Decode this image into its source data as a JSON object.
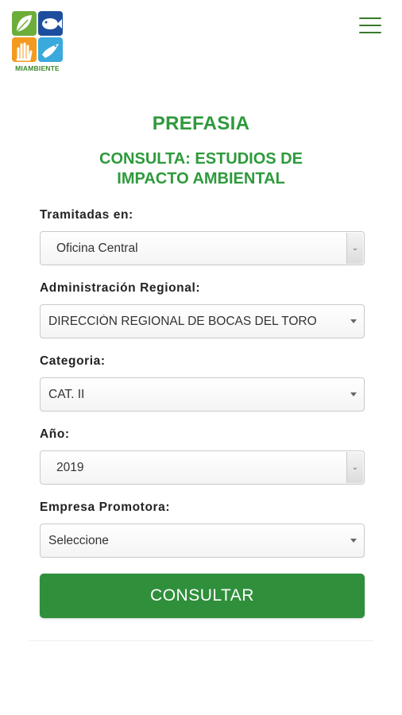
{
  "header": {
    "logo_text": "MIAMBIENTE",
    "menu_icon": "hamburger-menu-icon",
    "logo_colors": [
      "#6dad3a",
      "#1d4e9e",
      "#f39a1f",
      "#3aa9dc"
    ]
  },
  "page": {
    "title": "PREFASIA",
    "subtitle": "CONSULTA: ESTUDIOS DE IMPACTO AMBIENTAL",
    "accent_color": "#2e9a3c"
  },
  "form": {
    "tramitadas": {
      "label": "Tramitadas en:",
      "value": "Oficina Central"
    },
    "regional": {
      "label": "Administración Regional:",
      "value": "DIRECCIÓN REGIONAL DE BOCAS DEL TORO"
    },
    "categoria": {
      "label": "Categoria:",
      "value": "CAT. II"
    },
    "anio": {
      "label": "Año:",
      "value": "2019"
    },
    "empresa": {
      "label": "Empresa Promotora:",
      "value": "Seleccione"
    },
    "submit_label": "CONSULTAR",
    "button_color": "#2f8f3b"
  }
}
